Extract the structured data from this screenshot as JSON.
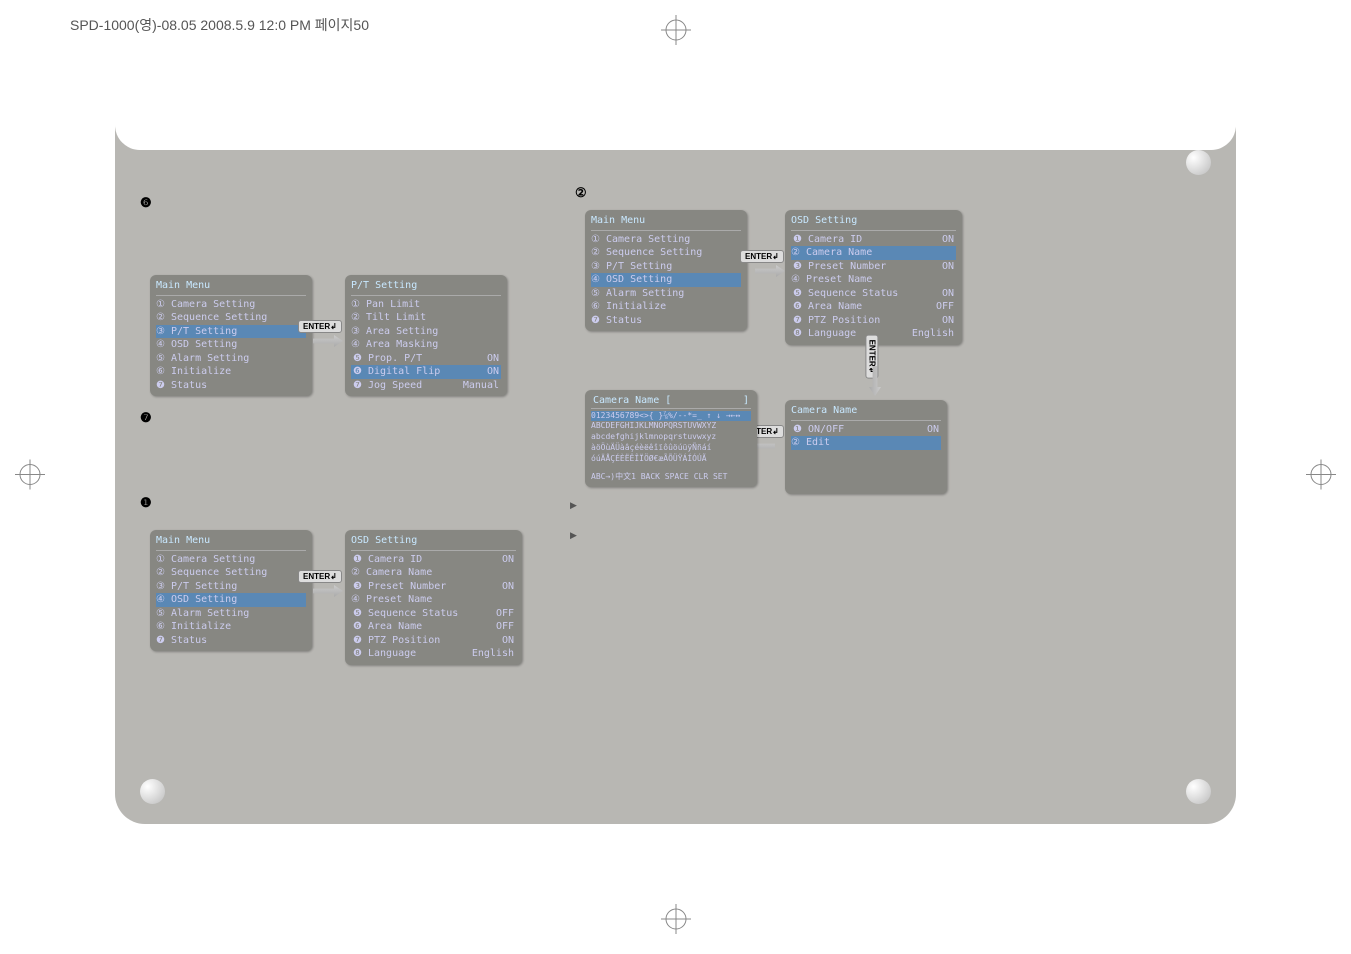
{
  "header": "SPD-1000(영)-08.05  2008.5.9  12:0 PM  페이지50",
  "sec6_num": "❻",
  "sec7_num": "❼",
  "sec1_num": "❶",
  "sec2_num": "②",
  "main_menu_title": "Main Menu",
  "mm_items": {
    "1": "① Camera Setting",
    "2": "② Sequence Setting",
    "3": "③ P/T Setting",
    "4": "④ OSD Setting",
    "5": "⑤ Alarm Setting",
    "6": "⑥ Initialize",
    "7": "❼ Status"
  },
  "pt_setting": {
    "title": "P/T Setting",
    "1": "① Pan Limit",
    "2": "② Tilt Limit",
    "3": "③ Area Setting",
    "4": "④ Area Masking",
    "5l": "❺ Prop. P/T",
    "5r": "ON",
    "6l": "❻ Digital Flip",
    "6r": "ON",
    "7l": "❼ Jog Speed",
    "7r": "Manual"
  },
  "osd_setting": {
    "title": "OSD Setting",
    "1l": "❶ Camera ID",
    "1r": "ON",
    "2": "② Camera Name",
    "3l": "❸ Preset Number",
    "3r": "ON",
    "4": "④ Preset Name",
    "5l": "❺ Sequence Status",
    "5r": "OFF",
    "6l": "❻ Area Name",
    "6r": "OFF",
    "7l": "❼ PTZ Position",
    "7r": "ON",
    "8l": "❽ Language",
    "8r": "English"
  },
  "osd_setting_r": {
    "5r": "ON"
  },
  "cam_name_sub": {
    "title": "Camera Name",
    "1l": "❶ ON/OFF",
    "1r": "ON",
    "2": "② Edit"
  },
  "cam_name_edit": {
    "title_l": "Camera Name  [",
    "title_r": "]",
    "line1": "0123456789<>{ }⅞%/--*=_ ↑ ↓ →←↔",
    "line2": "ABCDEFGHIJKLMNOPQRSTUVWXYZ",
    "line3": "abcdefghijklmnopqrstuvwxyz",
    "line4": "àöÖùÄÜàâçéèëêîïôûöúüÿÑñáí",
    "line5": "óúÄÅÇÉÈËÊÎÏÖØ€æÃÕÜŸÁÍÓÚÃ",
    "bottom": "ABC→)中文1 BACK SPACE CLR SET"
  },
  "enter_label": "ENTER↲",
  "ra": "▶",
  "blank": ""
}
